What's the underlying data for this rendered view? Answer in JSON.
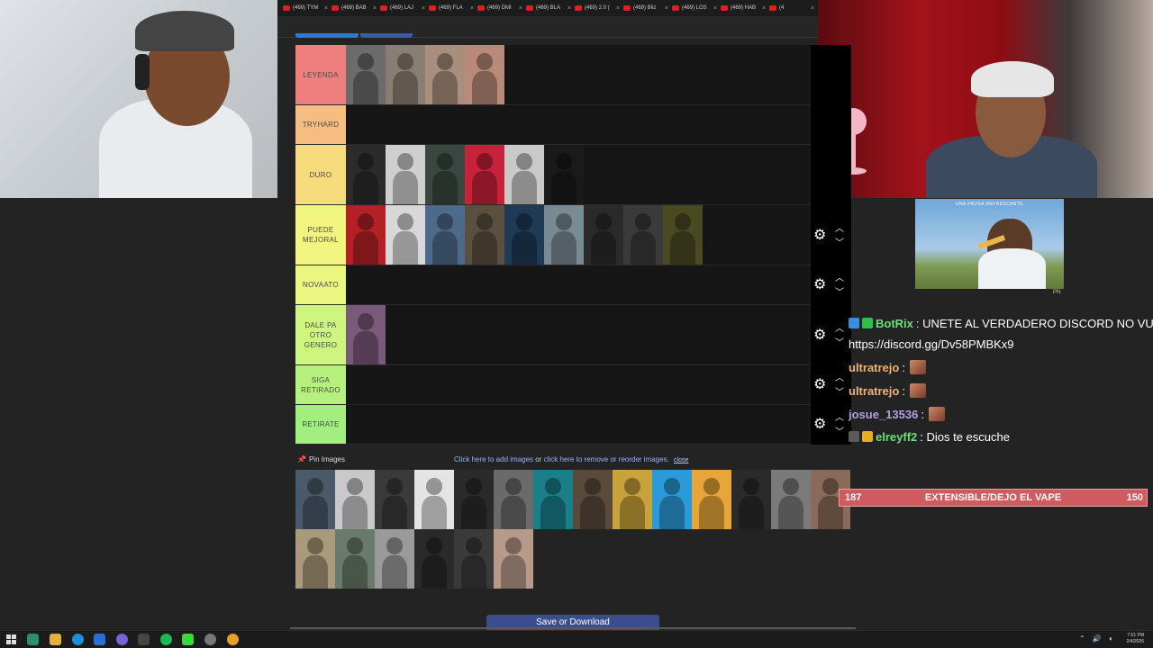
{
  "browser": {
    "tabs": [
      "(469) TYM",
      "(469) BAB",
      "(469) LAJ",
      "(469) FLA",
      "(469) DMI",
      "(469) BLA",
      "(469) 2.0 (",
      "(469) Bliz",
      "(469) LOS",
      "(469) HAB",
      "(4"
    ]
  },
  "tiers": [
    {
      "label": "LEYENDA",
      "color": "#ef7f7f",
      "items": [
        "#6b6b6b",
        "#8a7e74",
        "#a88e7c",
        "#b88a7a"
      ]
    },
    {
      "label": "TRYHARD",
      "color": "#f5bd7f",
      "items": []
    },
    {
      "label": "DURO",
      "color": "#f6dc7d",
      "items": [
        "#2b2b2b",
        "#cfcfcf",
        "#3a4740",
        "#c8213a",
        "#c9c9c9",
        "#1a1a1a"
      ]
    },
    {
      "label": "PUEDE MEJORAL",
      "color": "#f2f57f",
      "items": [
        "#b32126",
        "#d8d8d8",
        "#4e6a8a",
        "#5b5040",
        "#1f3a55",
        "#7a8a92",
        "#2a2a2a",
        "#3a3a3a",
        "#4a4a22"
      ]
    },
    {
      "label": "NOVAATO",
      "color": "#eaf67f",
      "items": []
    },
    {
      "label": "DALE PA OTRO GENERO",
      "color": "#cdf57f",
      "items": [
        "#7a5a7a"
      ]
    },
    {
      "label": "SIGA RETIRADO",
      "color": "#b6f17f",
      "items": []
    },
    {
      "label": "RETIRATE",
      "color": "#a2ee7f",
      "items": []
    }
  ],
  "pin": {
    "label": "Pin Images",
    "add_link": "Click here to add images",
    "or": "or",
    "remove_link": "click here to remove or reorder images.",
    "close": "close"
  },
  "pool": [
    "#4a5a6a",
    "#c9c9c9",
    "#3a3a3a",
    "#e4e4e4",
    "#2a2a2a",
    "#6a6a6a",
    "#1b7f8a",
    "#5a4a3a",
    "#c8a23a",
    "#2a9ad8",
    "#e8a63a",
    "#2a2a2a",
    "#7a7a7a",
    "#8a6a5a",
    "#a89a7a",
    "#6a7a6a",
    "#9a9a9a",
    "#2a2a2a",
    "#3a3a3a",
    "#b89a8a"
  ],
  "save_button": "Save or Download",
  "ad": {
    "title": "UNA PAUSA REFRESCANTE",
    "mark": "PN"
  },
  "chat": [
    {
      "user": "BotRix",
      "color": "#6ae07a",
      "text": ": UNETE AL VERDADERO DISCORD NO VU",
      "badges": [
        "#3a8ee0",
        "#2fbf4a"
      ]
    },
    {
      "user": "",
      "color": "#ffffff",
      "text": "https://discord.gg/Dv58PMBKx9",
      "badges": []
    },
    {
      "user": "ultratrejo",
      "color": "#f0b27a",
      "text": ":",
      "badges": [],
      "emote": true
    },
    {
      "user": "ultratrejo",
      "color": "#f0b27a",
      "text": ":",
      "badges": [],
      "emote": true
    },
    {
      "user": "josue_13536",
      "color": "#b59ee6",
      "text": ":",
      "badges": [],
      "emote": true
    },
    {
      "user": "elreyff2",
      "color": "#6ae07a",
      "text": ": Dios te escuche",
      "badges": [
        "#5a5a5a",
        "#e8b020"
      ]
    }
  ],
  "goal": {
    "current": "187",
    "title": "EXTENSIBLE/DEJO EL VAPE",
    "target": "150"
  },
  "clock": {
    "time": "7:51 PM",
    "date": "2/4/2026"
  }
}
